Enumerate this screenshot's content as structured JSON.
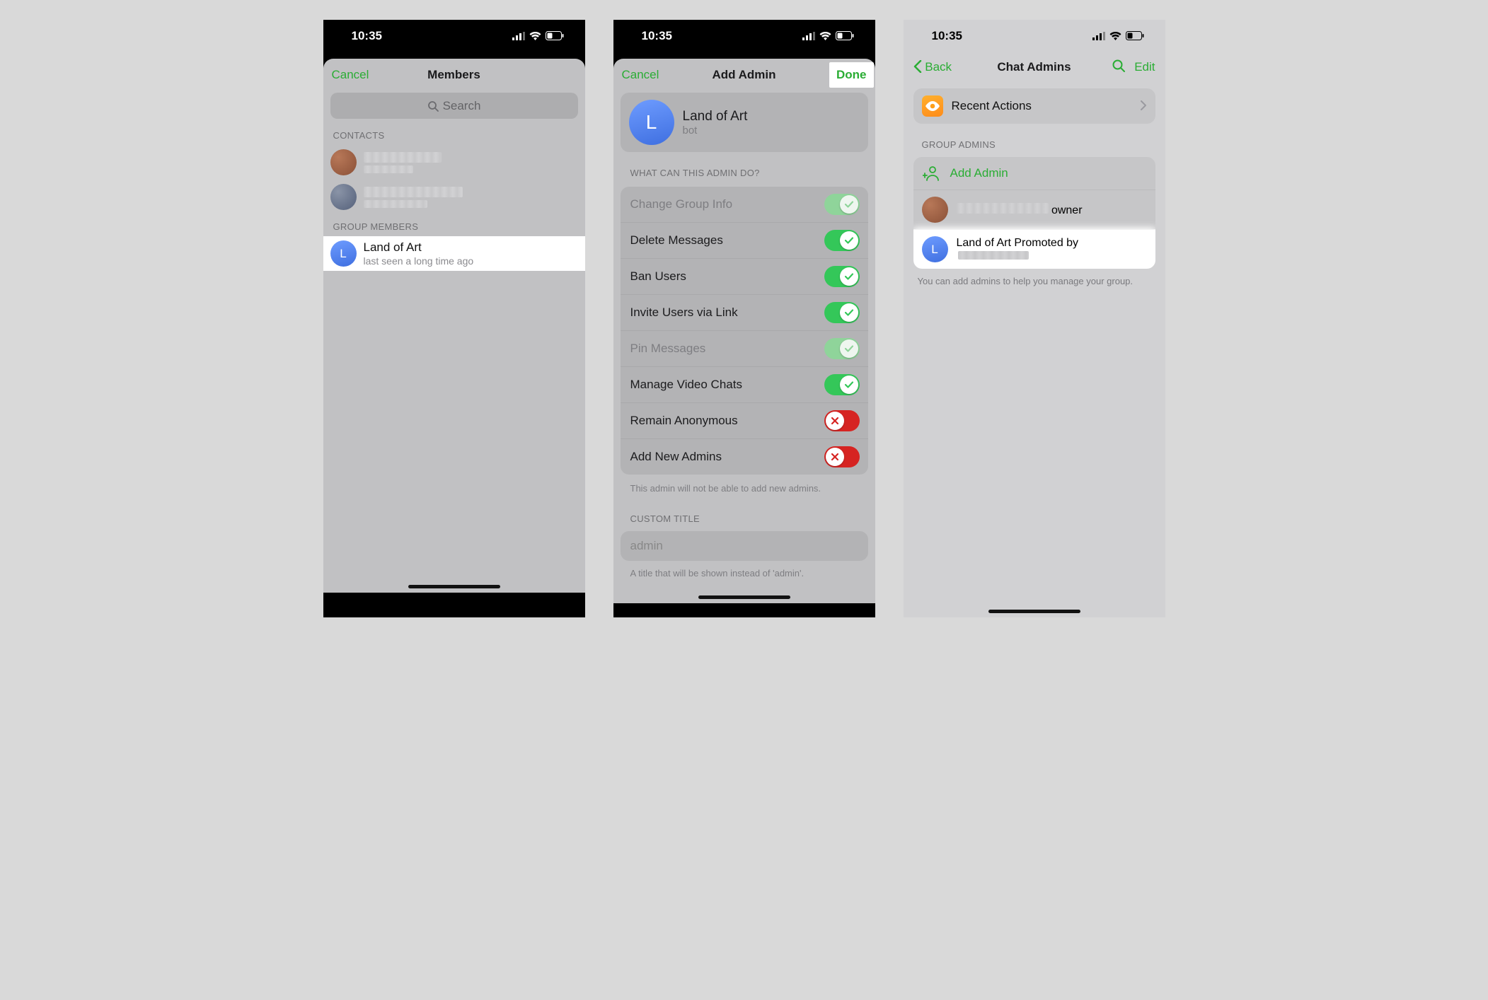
{
  "status": {
    "time": "10:35"
  },
  "colors": {
    "accent": "#2aad34",
    "toggle_on": "#34c759",
    "toggle_locked": "#8fd49a",
    "toggle_off": "#d62422",
    "eye_badge": "#ff9f1a"
  },
  "panel1": {
    "cancel": "Cancel",
    "title": "Members",
    "search_placeholder": "Search",
    "contacts_header": "CONTACTS",
    "group_members_header": "GROUP MEMBERS",
    "member": {
      "name": "Land of Art",
      "status": "last seen a long time ago",
      "initial": "L"
    }
  },
  "panel2": {
    "cancel": "Cancel",
    "title": "Add Admin",
    "done": "Done",
    "user": {
      "name": "Land of Art",
      "sub": "bot",
      "initial": "L"
    },
    "section_header": "WHAT CAN THIS ADMIN DO?",
    "perms": [
      {
        "label": "Change Group Info",
        "state": "locked_on"
      },
      {
        "label": "Delete Messages",
        "state": "on"
      },
      {
        "label": "Ban Users",
        "state": "on"
      },
      {
        "label": "Invite Users via Link",
        "state": "on"
      },
      {
        "label": "Pin Messages",
        "state": "locked_on"
      },
      {
        "label": "Manage Video Chats",
        "state": "on"
      },
      {
        "label": "Remain Anonymous",
        "state": "off"
      },
      {
        "label": "Add New Admins",
        "state": "off"
      }
    ],
    "help_text": "This admin will not be able to add new admins.",
    "custom_title_header": "CUSTOM TITLE",
    "custom_title_placeholder": "admin",
    "custom_title_help": "A title that will be shown instead of 'admin'."
  },
  "panel3": {
    "back": "Back",
    "title": "Chat Admins",
    "edit": "Edit",
    "recent_actions": "Recent Actions",
    "group_admins_header": "GROUP ADMINS",
    "add_admin": "Add Admin",
    "owner_sub": "owner",
    "admin": {
      "name": "Land of Art",
      "promoted_prefix": "Promoted by",
      "initial": "L"
    },
    "footer": "You can add admins to help you manage your group."
  }
}
